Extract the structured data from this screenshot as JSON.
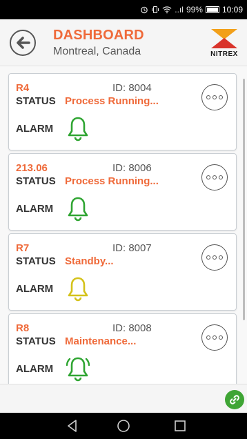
{
  "status_bar": {
    "signal_text": "..ıl",
    "battery": "99%",
    "battery_level": 99,
    "time": "10:09",
    "icons": [
      "alarm-clock-icon",
      "vibrate-icon",
      "wifi-icon",
      "signal-icon",
      "battery-icon"
    ]
  },
  "header": {
    "title": "DASHBOARD",
    "subtitle": "Montreal, Canada",
    "logo_text": "NITREX",
    "back_icon": "arrow-left-icon",
    "accent_color": "#ef6a3a"
  },
  "devices": [
    {
      "name": "R4",
      "id": "ID: 8004",
      "status_label": "STATUS",
      "status": "Process Running...",
      "alarm_label": "ALARM",
      "bell_color": "#2fa532",
      "bell_style": "normal",
      "more_icon": "more-options-icon"
    },
    {
      "name": "213.06",
      "id": "ID: 8006",
      "status_label": "STATUS",
      "status": "Process Running...",
      "alarm_label": "ALARM",
      "bell_color": "#2fa532",
      "bell_style": "normal",
      "more_icon": "more-options-icon"
    },
    {
      "name": "R7",
      "id": "ID: 8007",
      "status_label": "STATUS",
      "status": "Standby...",
      "alarm_label": "ALARM",
      "bell_color": "#d4c21a",
      "bell_style": "normal",
      "more_icon": "more-options-icon"
    },
    {
      "name": "R8",
      "id": "ID: 8008",
      "status_label": "STATUS",
      "status": "Maintenance...",
      "alarm_label": "ALARM",
      "bell_color": "#2fa532",
      "bell_style": "ringing",
      "more_icon": "more-options-icon"
    }
  ],
  "footer": {
    "link_icon": "link-icon",
    "link_color": "#3fa535"
  },
  "nav": {
    "back_icon": "nav-back-icon",
    "home_icon": "nav-home-icon",
    "recents_icon": "nav-recents-icon"
  }
}
